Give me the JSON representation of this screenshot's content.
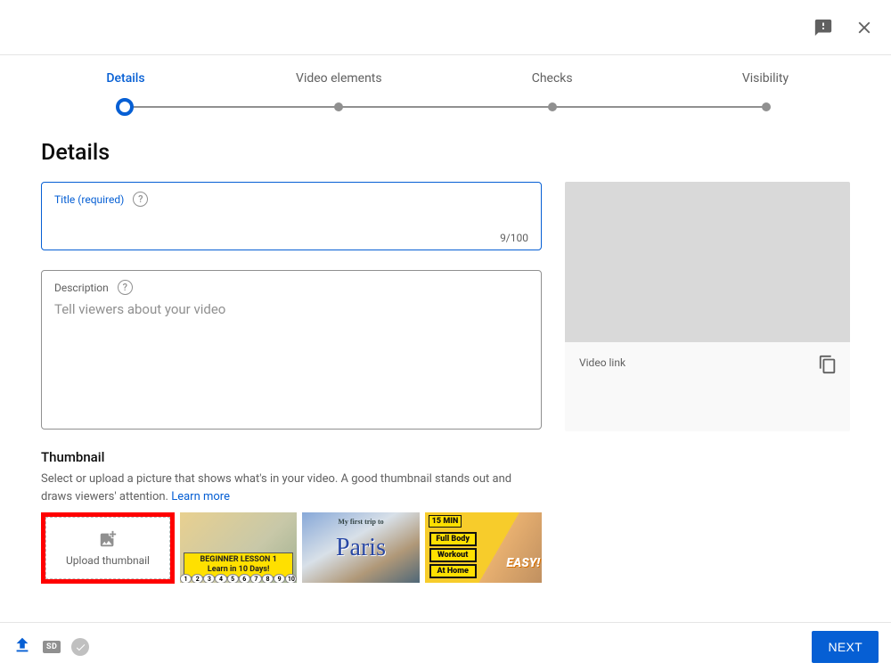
{
  "header": {},
  "stepper": {
    "steps": [
      {
        "label": "Details"
      },
      {
        "label": "Video elements"
      },
      {
        "label": "Checks"
      },
      {
        "label": "Visibility"
      }
    ]
  },
  "details": {
    "heading": "Details",
    "title_field": {
      "label": "Title (required)",
      "char_count": "9/100"
    },
    "desc_field": {
      "label": "Description",
      "placeholder": "Tell viewers about your video"
    }
  },
  "thumbnail": {
    "heading": "Thumbnail",
    "description": "Select or upload a picture that shows what's in your video. A good thumbnail stands out and draws viewers' attention. ",
    "learn_more": "Learn more",
    "upload_label": "Upload thumbnail",
    "samples": {
      "t1_line1": "BEGINNER LESSON 1",
      "t1_line2": "Learn in 10 Days!",
      "t2_small": "My first trip to",
      "t2_main": "Paris",
      "t3_hdr": "15 MIN",
      "t3_l1": "Full Body",
      "t3_l2": "Workout",
      "t3_l3": "At Home",
      "t3_easy": "EASY!"
    }
  },
  "preview": {
    "video_link_label": "Video link"
  },
  "footer": {
    "sd_label": "SD",
    "next_label": "NEXT"
  }
}
